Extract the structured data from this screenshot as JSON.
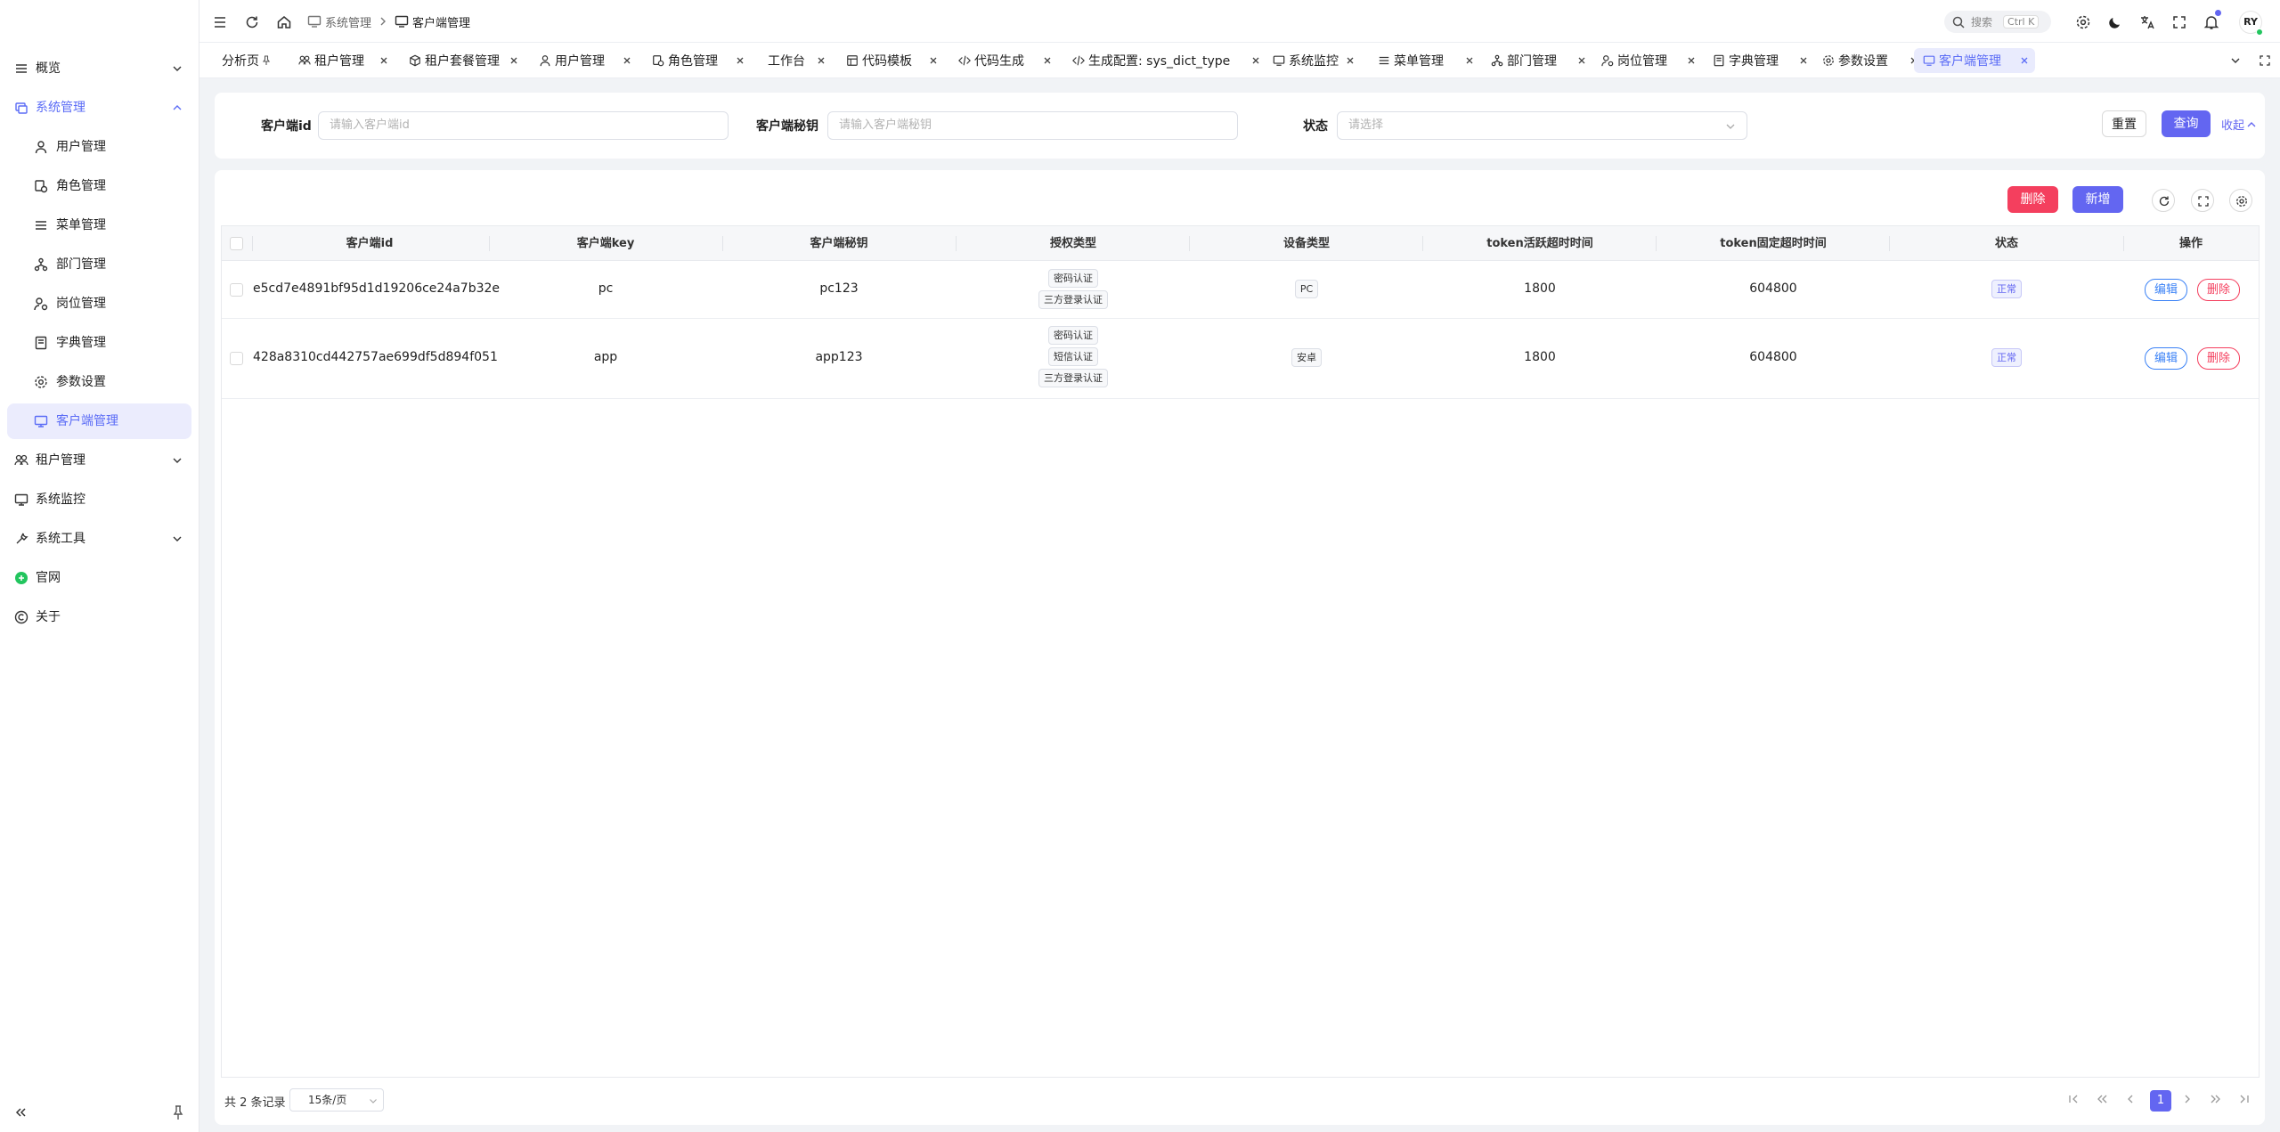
{
  "sidebar": {
    "items": [
      {
        "label": "概览",
        "icon": "dashboard-icon"
      },
      {
        "label": "系统管理",
        "icon": "settings-icon"
      },
      {
        "label": "用户管理",
        "icon": "user-icon"
      },
      {
        "label": "角色管理",
        "icon": "role-icon"
      },
      {
        "label": "菜单管理",
        "icon": "menu-icon"
      },
      {
        "label": "部门管理",
        "icon": "dept-icon"
      },
      {
        "label": "岗位管理",
        "icon": "post-icon"
      },
      {
        "label": "字典管理",
        "icon": "dict-icon"
      },
      {
        "label": "参数设置",
        "icon": "gear-icon"
      },
      {
        "label": "客户端管理",
        "icon": "client-icon"
      },
      {
        "label": "租户管理",
        "icon": "tenant-icon"
      },
      {
        "label": "系统监控",
        "icon": "monitor-icon"
      },
      {
        "label": "系统工具",
        "icon": "tool-icon"
      },
      {
        "label": "官网",
        "icon": "website-icon"
      },
      {
        "label": "关于",
        "icon": "copyright-icon"
      }
    ]
  },
  "header": {
    "breadcrumb": [
      "系统管理",
      "客户端管理"
    ],
    "search_label": "搜索",
    "search_shortcut": "Ctrl K",
    "avatar": "RY"
  },
  "tabs": [
    {
      "label": "分析页"
    },
    {
      "label": "租户管理"
    },
    {
      "label": "租户套餐管理"
    },
    {
      "label": "用户管理"
    },
    {
      "label": "角色管理"
    },
    {
      "label": "工作台"
    },
    {
      "label": "代码模板"
    },
    {
      "label": "代码生成"
    },
    {
      "label": "生成配置: sys_dict_type"
    },
    {
      "label": "系统监控"
    },
    {
      "label": "菜单管理"
    },
    {
      "label": "部门管理"
    },
    {
      "label": "岗位管理"
    },
    {
      "label": "字典管理"
    },
    {
      "label": "参数设置"
    },
    {
      "label": "客户端管理"
    }
  ],
  "filters": {
    "client_id": {
      "label": "客户端id",
      "placeholder": "请输入客户端id"
    },
    "client_secret": {
      "label": "客户端秘钥",
      "placeholder": "请输入客户端秘钥"
    },
    "status": {
      "label": "状态",
      "placeholder": "请选择"
    },
    "reset": "重置",
    "query": "查询",
    "collapse": "收起"
  },
  "toolbar": {
    "delete": "删除",
    "add": "新增"
  },
  "table": {
    "headers": [
      "客户端id",
      "客户端key",
      "客户端秘钥",
      "授权类型",
      "设备类型",
      "token活跃超时时间",
      "token固定超时时间",
      "状态",
      "操作"
    ],
    "rows": [
      {
        "client_id": "e5cd7e4891bf95d1d19206ce24a7b32e",
        "client_key": "pc",
        "client_secret": "pc123",
        "grant_types": [
          "密码认证",
          "三方登录认证"
        ],
        "device": "PC",
        "active_timeout": "1800",
        "fixed_timeout": "604800",
        "status": "正常",
        "edit": "编辑",
        "delete": "删除"
      },
      {
        "client_id": "428a8310cd442757ae699df5d894f051",
        "client_key": "app",
        "client_secret": "app123",
        "grant_types": [
          "密码认证",
          "短信认证",
          "三方登录认证"
        ],
        "device": "安卓",
        "active_timeout": "1800",
        "fixed_timeout": "604800",
        "status": "正常",
        "edit": "编辑",
        "delete": "删除"
      }
    ]
  },
  "pagination": {
    "total": "共 2 条记录",
    "page_size": "15条/页",
    "current": "1"
  },
  "colors": {
    "primary": "#6366f1",
    "danger": "#f43f5e",
    "edit": "#3b82f6"
  }
}
